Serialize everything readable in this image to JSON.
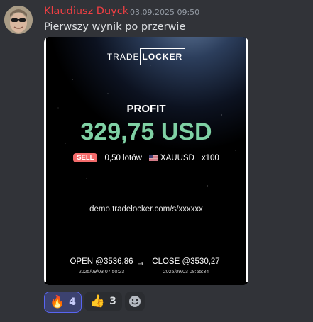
{
  "message": {
    "username": "Klaudiusz Duyck",
    "timestamp": "03.09.2025 09:50",
    "text": "Pierwszy wynik po przerwie"
  },
  "card": {
    "brand_prefix": "TRADE",
    "brand_suffix": "LOCKER",
    "profit_label": "PROFIT",
    "profit_value": "329,75 USD",
    "side": "SELL",
    "lots": "0,50 lotów",
    "symbol": "XAUUSD",
    "leverage": "x100",
    "share_link": "demo.tradelocker.com/s/xxxxxx",
    "open_label": "OPEN @3536,86",
    "open_time": "2025/09/03 07:50:23",
    "close_label": "CLOSE @3530,27",
    "close_time": "2025/09/03 08:55:34",
    "arrow": "→",
    "colors": {
      "profit": "#7fd1a4",
      "sell": "#f46b6b",
      "username": "#f23f43"
    }
  },
  "reactions": [
    {
      "emoji": "🔥",
      "icon": "fire-icon",
      "count": "4",
      "active": true
    },
    {
      "emoji": "👍",
      "icon": "thumbs-up-icon",
      "count": "3",
      "active": false
    }
  ]
}
